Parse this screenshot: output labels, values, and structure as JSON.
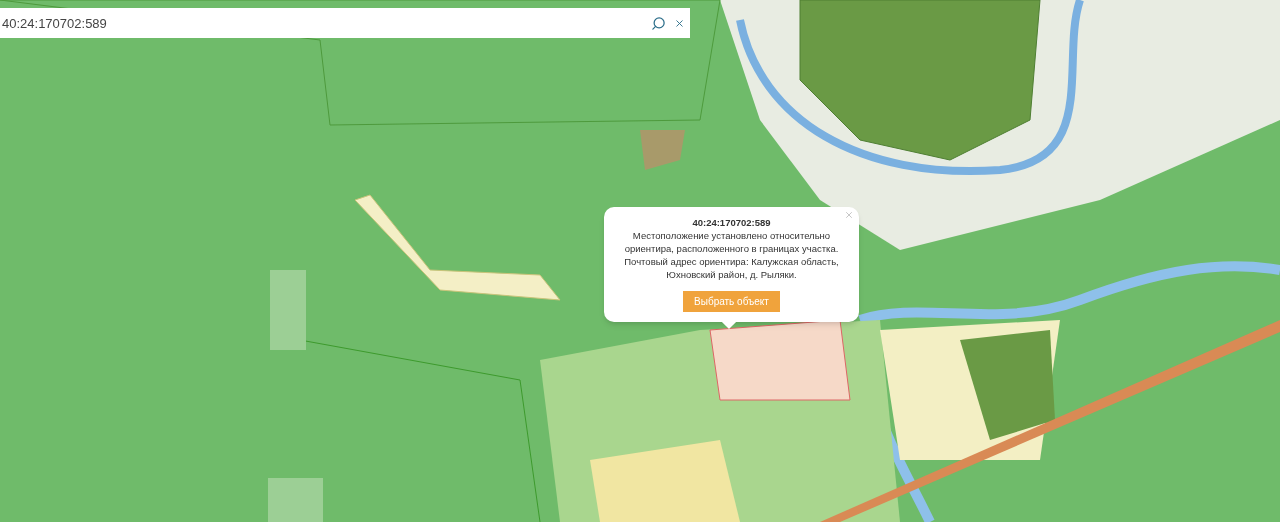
{
  "search": {
    "value": "40:24:170702:589"
  },
  "popup": {
    "title": "40:24:170702:589",
    "text": "Местоположение установлено относительно ориентира, расположенного в границах участка. Почтовый адрес ориентира: Калужская область, Юхновский район, д. Рыляки.",
    "button": "Выбрать объект"
  }
}
